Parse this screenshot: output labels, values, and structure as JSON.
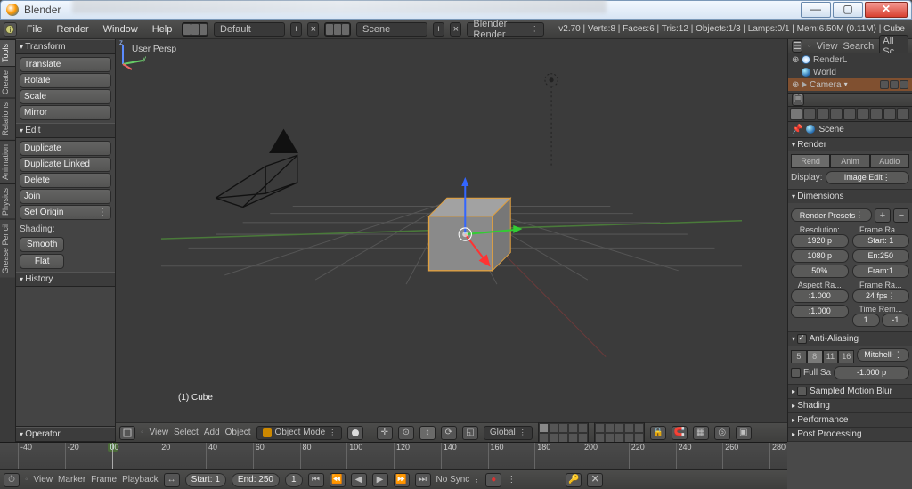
{
  "window": {
    "title": "Blender"
  },
  "win_buttons": {
    "min": "—",
    "max": "▢",
    "close": "✕"
  },
  "top_menu": [
    "File",
    "Render",
    "Window",
    "Help"
  ],
  "screen_layout": "Default",
  "scene_name": "Scene",
  "engine": "Blender Render",
  "stats": "v2.70 | Verts:8 | Faces:6 | Tris:12 | Objects:1/3 | Lamps:0/1 | Mem:6.50M (0.11M) | Cube",
  "tool_tabs": [
    "Tools",
    "Create",
    "Relations",
    "Animation",
    "Physics",
    "Grease Pencil"
  ],
  "toolpanel": {
    "transform": {
      "title": "Transform",
      "items": [
        "Translate",
        "Rotate",
        "Scale",
        "Mirror"
      ]
    },
    "edit": {
      "title": "Edit",
      "items": [
        "Duplicate",
        "Duplicate Linked",
        "Delete",
        "Join"
      ],
      "origin": "Set Origin",
      "shading_label": "Shading:",
      "smooth": "Smooth",
      "flat": "Flat"
    },
    "history": {
      "title": "History"
    },
    "operator": {
      "title": "Operator"
    }
  },
  "view3d": {
    "persp_label": "User Persp",
    "object_label": "(1) Cube",
    "header_menus": [
      "View",
      "Select",
      "Add",
      "Object"
    ],
    "mode": "Object Mode",
    "orientation": "Global"
  },
  "timeline": {
    "ticks": [
      -40,
      -20,
      0,
      20,
      40,
      60,
      80,
      100,
      120,
      140,
      160,
      180,
      200,
      220,
      240,
      260,
      280
    ],
    "current_frame": 0,
    "header_menus": [
      "View",
      "Marker",
      "Frame",
      "Playback"
    ],
    "start_label": "Start:",
    "start": 1,
    "end_label": "End:",
    "end": 250,
    "cur": 1,
    "sync": "No Sync"
  },
  "outliner": {
    "header": [
      "View",
      "Search",
      "All Sc..."
    ],
    "items": [
      {
        "name": "RenderL",
        "icon": "scene"
      },
      {
        "name": "World",
        "icon": "world"
      },
      {
        "name": "Camera",
        "icon": "cam",
        "selected": true
      }
    ]
  },
  "props": {
    "breadcrumb": "Scene",
    "render": {
      "title": "Render",
      "tabs": [
        "Rend",
        "Anim",
        "Audio"
      ],
      "display_label": "Display:",
      "display": "Image Edit"
    },
    "dimensions": {
      "title": "Dimensions",
      "presets": "Render Presets",
      "resolution_hdr": "Resolution:",
      "framerange_hdr": "Frame Ra...",
      "res_x": "1920 p",
      "res_y": "1080 p",
      "res_pct": "50%",
      "start": "Start: 1",
      "end": "En:250",
      "step": "Fram:1",
      "aspect_hdr": "Aspect Ra...",
      "framerate_hdr": "Frame Ra...",
      "asp_x": ":1.000",
      "asp_y": ":1.000",
      "fps": "24 fps",
      "time_remap": "Time Rem...",
      "remap1": "1",
      "remap2": "-1"
    },
    "aa": {
      "title": "Anti-Aliasing",
      "checked": true,
      "samples": [
        "5",
        "8",
        "11",
        "16"
      ],
      "sel": "8",
      "filter": "Mitchell-",
      "full_label": "Full Sa",
      "size": "-1.000 p"
    },
    "collapsed": [
      "Sampled Motion Blur",
      "Shading",
      "Performance",
      "Post Processing"
    ]
  }
}
